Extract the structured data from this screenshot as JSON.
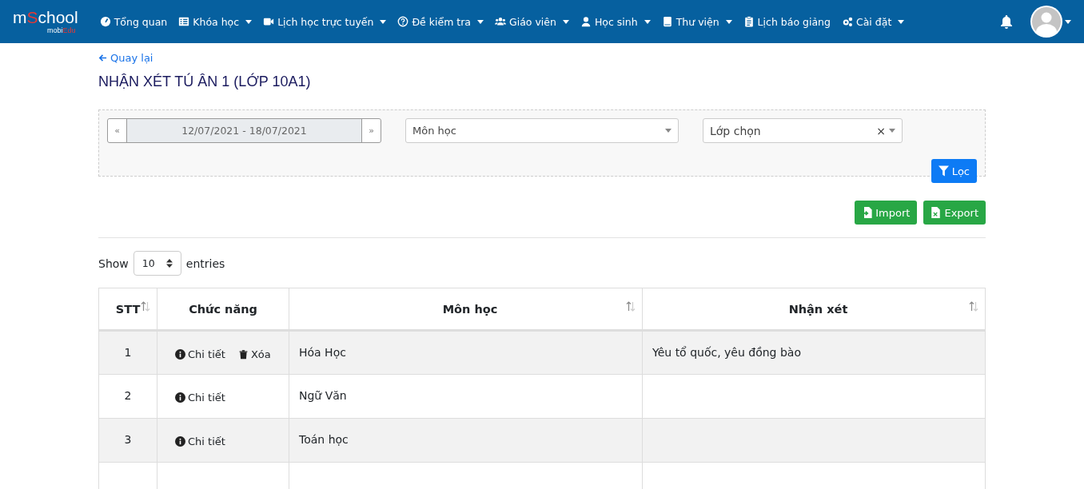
{
  "navbar": {
    "logo": [
      {
        "text": "m",
        "accent": false
      },
      {
        "text": "S",
        "accent": true
      },
      {
        "text": "chool",
        "accent": false
      }
    ],
    "logo_sub": [
      {
        "text": "mobi",
        "accent": false
      },
      {
        "text": "Edu",
        "accent": true
      }
    ],
    "items": [
      {
        "kind": "gauge",
        "label": "Tổng quan",
        "dropdown": false
      },
      {
        "kind": "list",
        "label": "Khóa học",
        "dropdown": true
      },
      {
        "kind": "video",
        "label": "Lịch học trực tuyến",
        "dropdown": true
      },
      {
        "kind": "question",
        "label": "Đề kiểm tra",
        "dropdown": true
      },
      {
        "kind": "users",
        "label": "Giáo viên",
        "dropdown": true
      },
      {
        "kind": "user",
        "label": "Học sinh",
        "dropdown": true
      },
      {
        "kind": "book",
        "label": "Thư viện",
        "dropdown": true
      },
      {
        "kind": "clipboard",
        "label": "Lịch báo giảng",
        "dropdown": false
      },
      {
        "kind": "cogs",
        "label": "Cài đặt",
        "dropdown": true
      }
    ]
  },
  "back_link": "Quay lại",
  "title": "NHẬN XÉT TÚ ÂN 1 (LỚP 10A1)",
  "filters": {
    "prev": "«",
    "date_range": "12/07/2021 - 18/07/2021",
    "next": "»",
    "subject_placeholder": "Môn học",
    "class_placeholder": "Lớp chọn",
    "clear": "×",
    "filter_button": "Lọc"
  },
  "actions": [
    {
      "kind": "import",
      "label": "Import"
    },
    {
      "kind": "export",
      "label": "Export"
    }
  ],
  "length": {
    "before": "Show",
    "value": "10",
    "after": "entries"
  },
  "table": {
    "columns": [
      {
        "label": "STT",
        "sortable": true
      },
      {
        "label": "Chức năng",
        "sortable": false
      },
      {
        "label": "Môn học",
        "sortable": true
      },
      {
        "label": "Nhận xét",
        "sortable": true
      }
    ],
    "rows": [
      {
        "stt": "1",
        "actions": [
          {
            "kind": "detail",
            "label": "Chi tiết"
          },
          {
            "kind": "delete",
            "label": "Xóa"
          }
        ],
        "subject": "Hóa Học",
        "comment": "Yêu tổ quốc, yêu đồng bào"
      },
      {
        "stt": "2",
        "actions": [
          {
            "kind": "detail",
            "label": "Chi tiết"
          }
        ],
        "subject": "Ngữ Văn"
      },
      {
        "stt": "3",
        "actions": [
          {
            "kind": "detail",
            "label": "Chi tiết"
          }
        ],
        "subject": "Toán học"
      }
    ]
  }
}
